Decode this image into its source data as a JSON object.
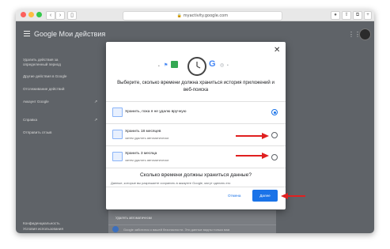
{
  "browser": {
    "url": "myactivity.google.com",
    "traffic_lights": [
      "#fc605c",
      "#fdbc40",
      "#34c84a"
    ]
  },
  "app": {
    "logo_google": "Google",
    "title": "Мои действия"
  },
  "sidebar": {
    "items": [
      {
        "label": "Удалить действия за определенный период"
      },
      {
        "label": "Другие действия в Google"
      },
      {
        "label": "Отслеживание действий"
      },
      {
        "label": "Аккаунт Google"
      },
      {
        "label": "Справка"
      },
      {
        "label": "Отправить отзыв"
      },
      {
        "label": "Конфиденциальность"
      },
      {
        "label": "Условия использования"
      }
    ]
  },
  "background": {
    "card_text": "Удалять автоматически",
    "bottom_text": "Google заботится о вашей безопасности. Эти данные видны только вам"
  },
  "dialog": {
    "heading": "Выберите, сколько времени должна храниться история приложений и веб-поиска",
    "options": [
      {
        "label": "Хранить, пока я не удалю вручную",
        "sub": "",
        "selected": true
      },
      {
        "label": "Хранить 18 месяцев",
        "sub": "затем удалять автоматически",
        "selected": false
      },
      {
        "label": "Хранить 3 месяца",
        "sub": "затем удалять автоматически",
        "selected": false
      }
    ],
    "question": "Сколько времени должны храниться данные?",
    "question_text": "Данные, которые вы разрешаете сохранять в аккаунте Google, могут сделать его",
    "cancel_label": "Отмена",
    "next_label": "Далее"
  },
  "colors": {
    "accent": "#1a73e8",
    "arrow": "#e02020",
    "overlay": "#5f6368"
  }
}
